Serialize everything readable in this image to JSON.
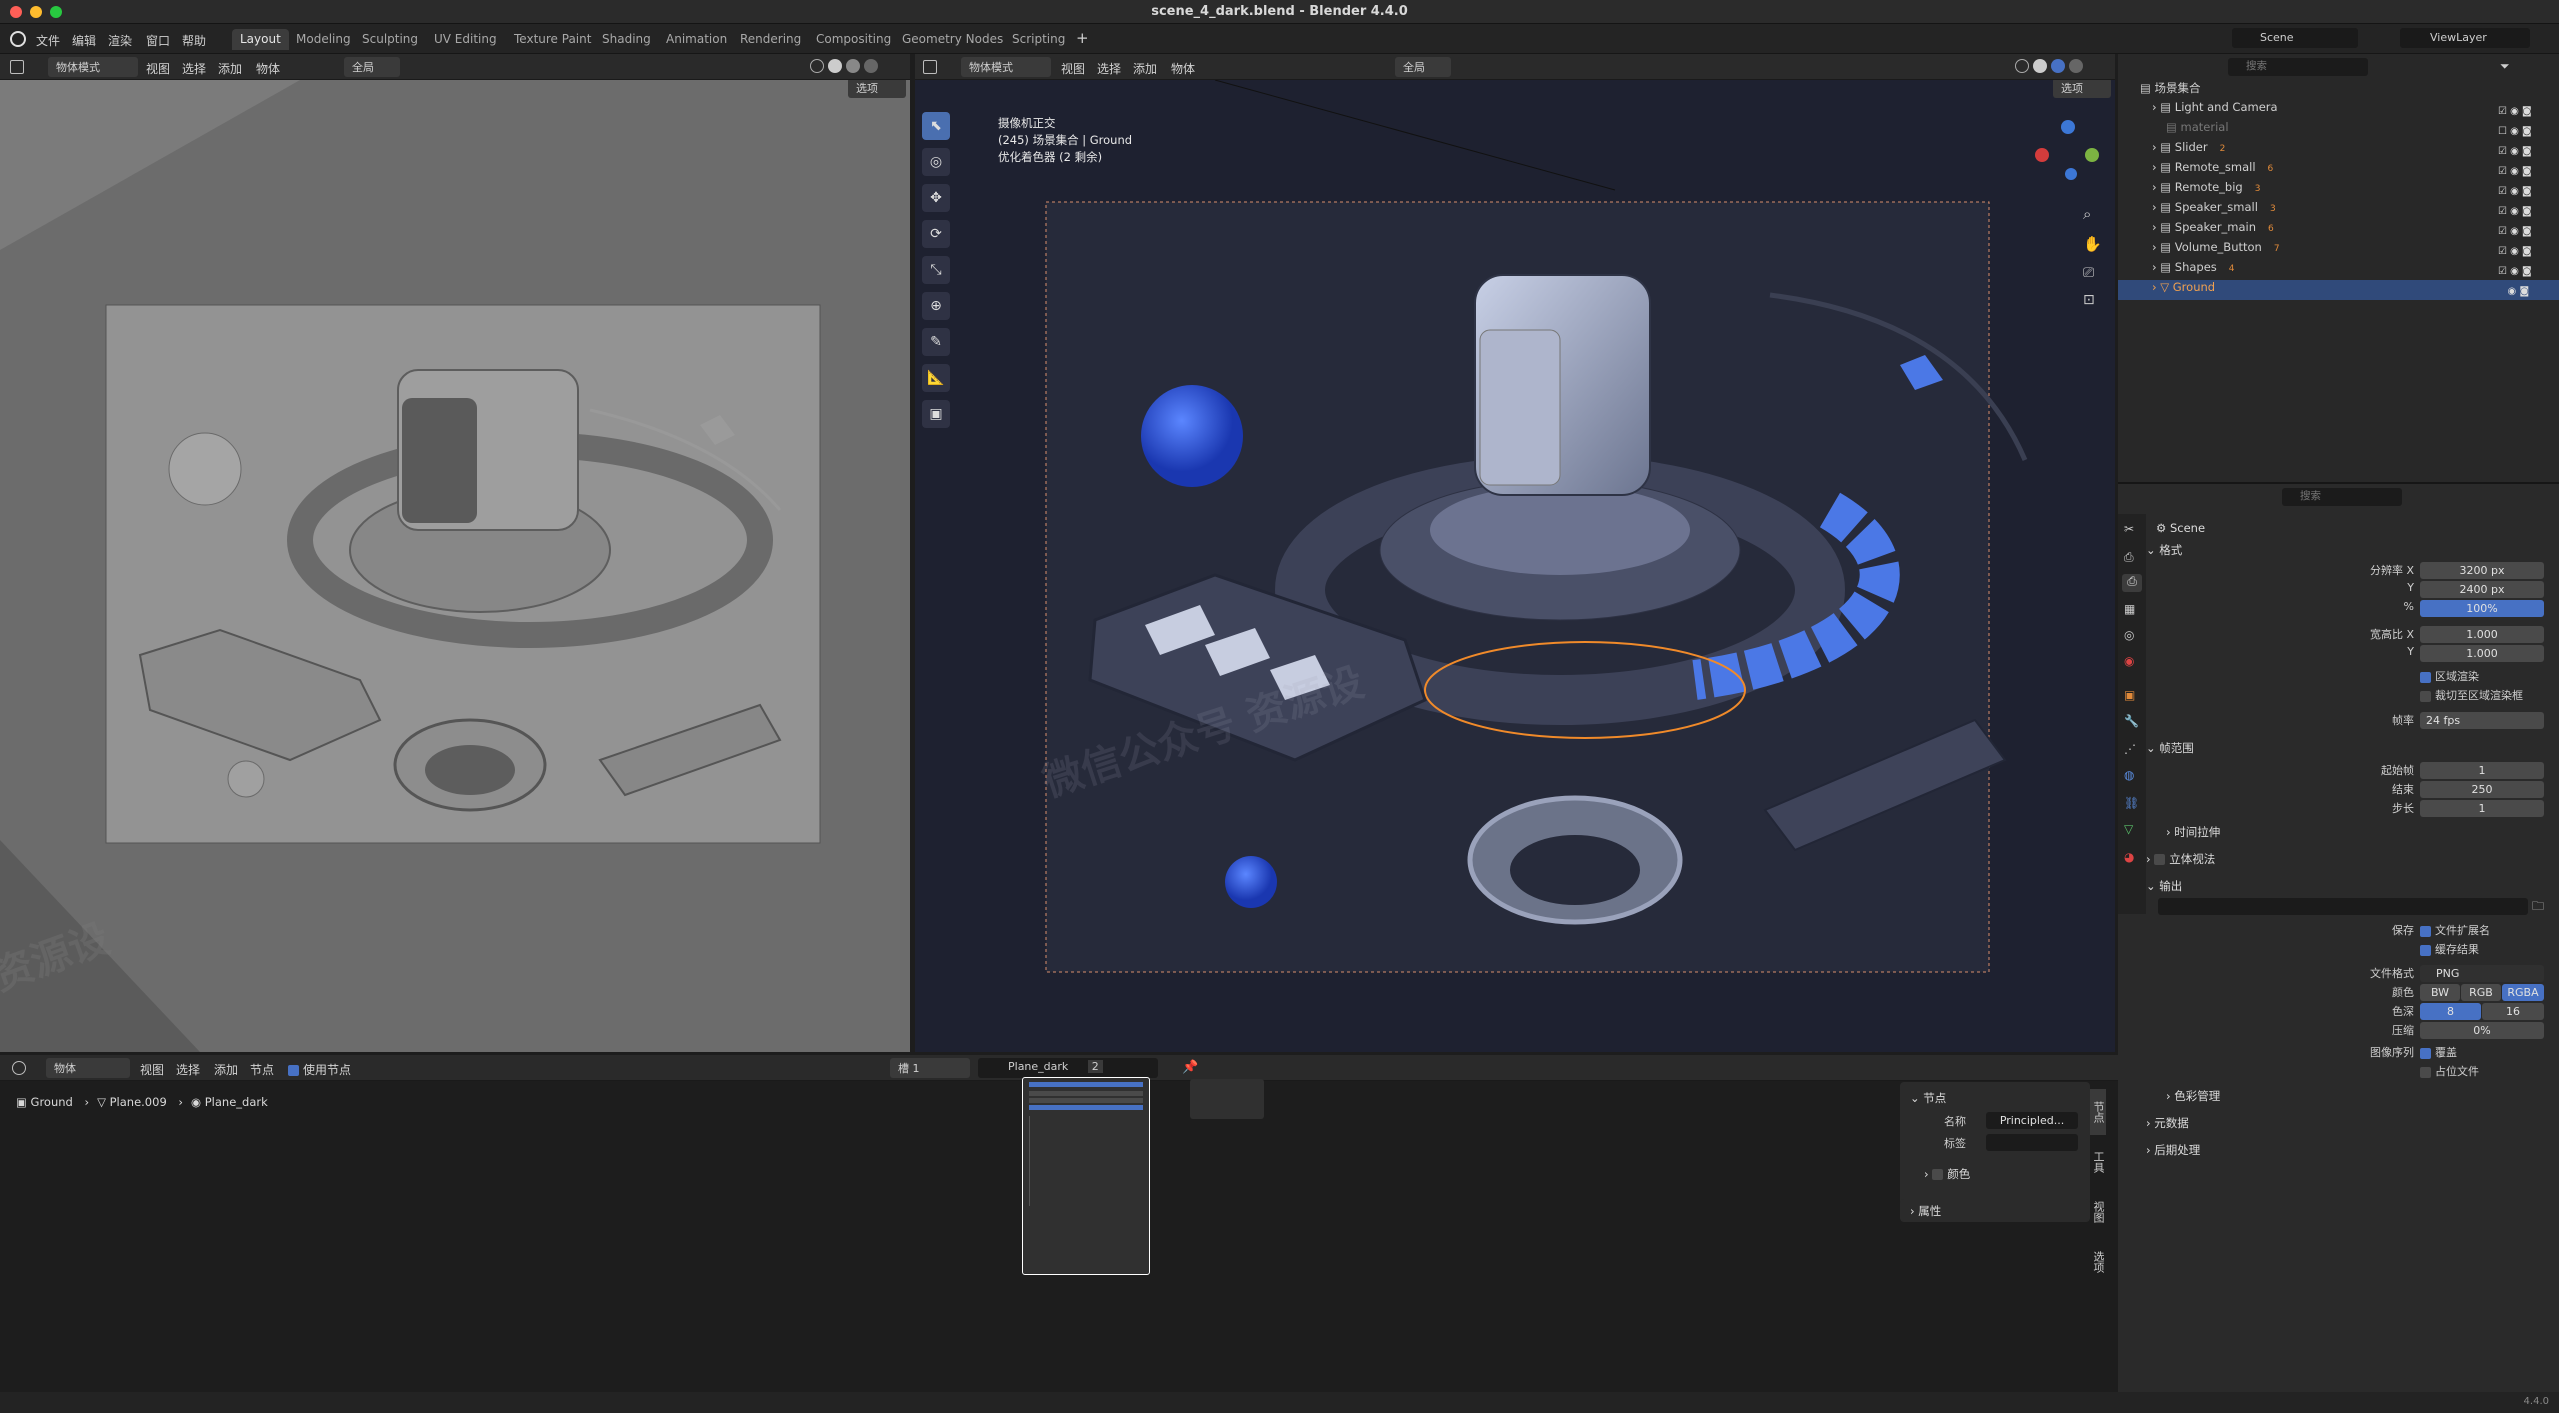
{
  "window": {
    "title": "scene_4_dark.blend - Blender 4.4.0",
    "traffic": [
      "#fe5f57",
      "#febc2e",
      "#28c840"
    ]
  },
  "menu": [
    "文件",
    "编辑",
    "渲染",
    "窗口",
    "帮助"
  ],
  "workspaces": [
    "Layout",
    "Modeling",
    "Sculpting",
    "UV Editing",
    "Texture Paint",
    "Shading",
    "Animation",
    "Rendering",
    "Compositing",
    "Geometry Nodes",
    "Scripting"
  ],
  "active_workspace": "Layout",
  "scene": {
    "label": "Scene",
    "view_layer": "ViewLayer"
  },
  "left_viewport": {
    "mode": "物体模式",
    "menus": [
      "视图",
      "选择",
      "添加",
      "物体"
    ],
    "transform": "全局",
    "options": "选项",
    "watermark": "资源设"
  },
  "right_viewport": {
    "mode": "物体模式",
    "menus": [
      "视图",
      "选择",
      "添加",
      "物体"
    ],
    "transform": "全局",
    "options": "选项",
    "info_line1": "摄像机正交",
    "info_line2": "(245) 场景集合 | Ground",
    "info_line3": "优化着色器 (2 剩余)",
    "watermark1": "微信公众号 资源设",
    "watermark2": "微信公"
  },
  "outliner": {
    "search_placeholder": "搜索",
    "root": "场景集合",
    "items": [
      {
        "label": "Light and Camera"
      },
      {
        "label": "material"
      },
      {
        "label": "Slider",
        "badge": "2"
      },
      {
        "label": "Remote_small",
        "badge": "6"
      },
      {
        "label": "Remote_big",
        "badge": "3"
      },
      {
        "label": "Speaker_small",
        "badge": "3"
      },
      {
        "label": "Speaker_main",
        "badge": "6"
      },
      {
        "label": "Volume_Button",
        "badge": "7"
      },
      {
        "label": "Shapes",
        "badge": "4"
      },
      {
        "label": "Ground"
      }
    ]
  },
  "properties": {
    "search_placeholder": "搜索",
    "scene_name": "Scene",
    "format": {
      "title": "格式",
      "res_x_label": "分辨率 X",
      "res_x": "3200 px",
      "res_y_label": "Y",
      "res_y": "2400 px",
      "pct_label": "%",
      "pct": "100%",
      "aspect_x_label": "宽高比 X",
      "aspect_x": "1.000",
      "aspect_y_label": "Y",
      "aspect_y": "1.000",
      "region_render": "区域渲染",
      "crop": "裁切至区域渲染框",
      "fps_label": "帧率",
      "fps": "24 fps"
    },
    "frame_range": {
      "title": "帧范围",
      "start_label": "起始帧",
      "start": "1",
      "end_label": "结束",
      "end": "250",
      "step_label": "步长",
      "step": "1",
      "time_stretch": "时间拉伸"
    },
    "stereoscopy": "立体视法",
    "output": {
      "title": "输出",
      "save_label": "保存",
      "file_ext": "文件扩展名",
      "cache": "缓存结果",
      "format_label": "文件格式",
      "format": "PNG",
      "color_label": "颜色",
      "color_opts": [
        "BW",
        "RGB",
        "RGBA"
      ],
      "depth_label": "色深",
      "depth_opts": [
        "8",
        "16"
      ],
      "compress_label": "压缩",
      "compress": "0%",
      "seq_label": "图像序列",
      "overwrite": "覆盖",
      "placeholders": "占位文件",
      "color_mgmt": "色彩管理"
    },
    "metadata": "元数据",
    "postprocess": "后期处理"
  },
  "node_editor": {
    "mode": "物体",
    "menus": [
      "视图",
      "选择",
      "添加",
      "节点"
    ],
    "use_nodes": "使用节点",
    "slot": "槽 1",
    "material": "Plane_dark",
    "users": "2",
    "breadcrumb": [
      "Ground",
      "Plane.009",
      "Plane_dark"
    ],
    "panel": {
      "node_title": "节点",
      "name_label": "名称",
      "name_value": "Principled...",
      "label_label": "标签",
      "color_label": "颜色",
      "props_label": "属性"
    },
    "side_tabs": [
      "节点",
      "工具",
      "视图",
      "选项"
    ]
  },
  "status": {
    "version": "4.4.0"
  }
}
